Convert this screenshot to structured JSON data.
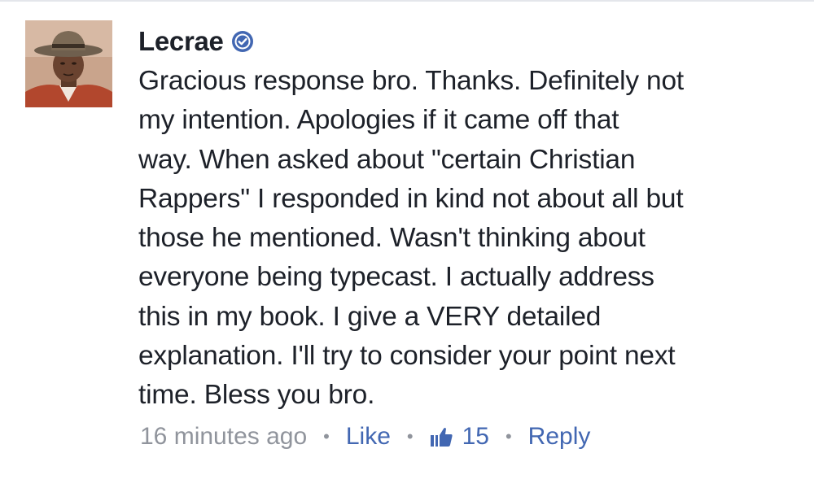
{
  "comment": {
    "author": "Lecrae",
    "verified_icon": "verified-badge-icon",
    "text_lines": [
      "Gracious response bro. Thanks. Definitely not",
      "my intention. Apologies if it came off that",
      "way. When asked about \"certain Christian",
      "Rappers\" I responded in kind not about all but",
      "those he mentioned. Wasn't thinking about",
      "everyone being typecast. I actually address",
      "this in my book. I give a VERY detailed",
      "explanation. I'll try to consider your point next",
      "time. Bless you bro."
    ],
    "timestamp": "16 minutes ago",
    "separator": "•",
    "like_label": "Like",
    "like_count": "15",
    "reply_label": "Reply"
  },
  "colors": {
    "text": "#1d2129",
    "meta": "#90949c",
    "link": "#4267b2",
    "badge": "#4267b2"
  }
}
